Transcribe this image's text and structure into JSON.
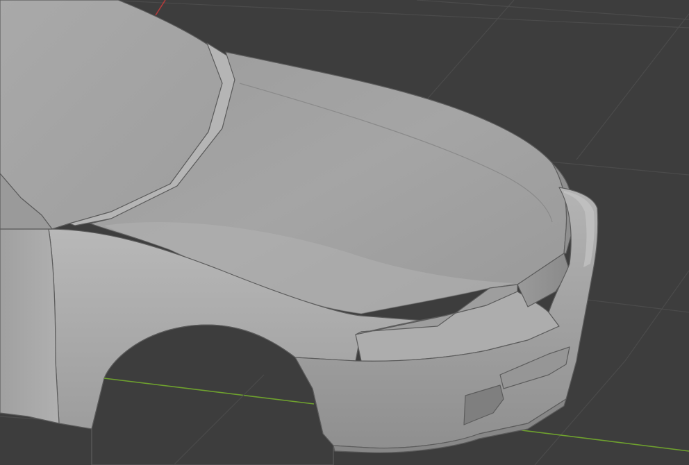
{
  "viewport": {
    "type": "3d-viewport",
    "background_color": "#3d3d3d",
    "grid_color": "#4a4a4a",
    "x_axis_color": "#b33a3a",
    "y_axis_color": "#6fa22e",
    "model": {
      "name": "car-body-front",
      "shading": "solid",
      "base_color": "#a6a6a6",
      "highlight_color": "#c4c4c4",
      "shadow_color": "#7a7a7a",
      "edge_color": "#5c5c5c"
    }
  }
}
